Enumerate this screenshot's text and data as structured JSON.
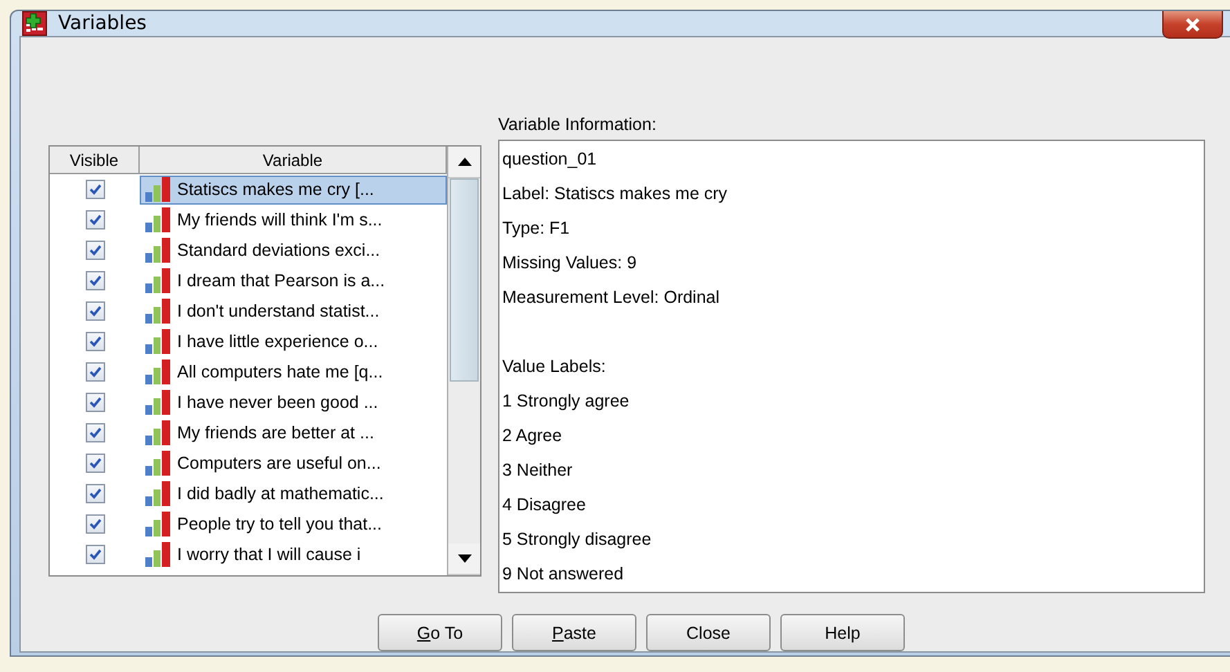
{
  "window": {
    "title": "Variables"
  },
  "table": {
    "columns": [
      "Visible",
      "Variable"
    ],
    "rows": [
      {
        "visible": true,
        "selected": true,
        "variable": "Statiscs makes me cry [..."
      },
      {
        "visible": true,
        "selected": false,
        "variable": "My friends will think I'm s..."
      },
      {
        "visible": true,
        "selected": false,
        "variable": "Standard deviations exci..."
      },
      {
        "visible": true,
        "selected": false,
        "variable": "I dream that Pearson is a..."
      },
      {
        "visible": true,
        "selected": false,
        "variable": "I don't understand statist..."
      },
      {
        "visible": true,
        "selected": false,
        "variable": "I have little experience o..."
      },
      {
        "visible": true,
        "selected": false,
        "variable": "All computers hate me [q..."
      },
      {
        "visible": true,
        "selected": false,
        "variable": "I have never been good ..."
      },
      {
        "visible": true,
        "selected": false,
        "variable": "My friends are better at ..."
      },
      {
        "visible": true,
        "selected": false,
        "variable": "Computers are useful on..."
      },
      {
        "visible": true,
        "selected": false,
        "variable": "I did badly at mathematic..."
      },
      {
        "visible": true,
        "selected": false,
        "variable": "People try to tell you that..."
      },
      {
        "visible": true,
        "selected": false,
        "variable": "I worry that I will cause i"
      }
    ]
  },
  "variable_information": {
    "heading": "Variable Information:",
    "lines": [
      "question_01",
      "Label:  Statiscs makes me cry",
      "Type:  F1",
      "Missing Values:  9",
      "Measurement Level:  Ordinal"
    ],
    "value_labels_heading": "Value Labels:",
    "value_labels": [
      "1 Strongly agree",
      "2 Agree",
      "3 Neither",
      "4 Disagree",
      "5 Strongly disagree",
      "9 Not answered"
    ]
  },
  "buttons": [
    {
      "label": "Go To",
      "underline_first": true
    },
    {
      "label": "Paste",
      "underline_first": true
    },
    {
      "label": "Close",
      "underline_first": false
    },
    {
      "label": "Help",
      "underline_first": false
    }
  ]
}
